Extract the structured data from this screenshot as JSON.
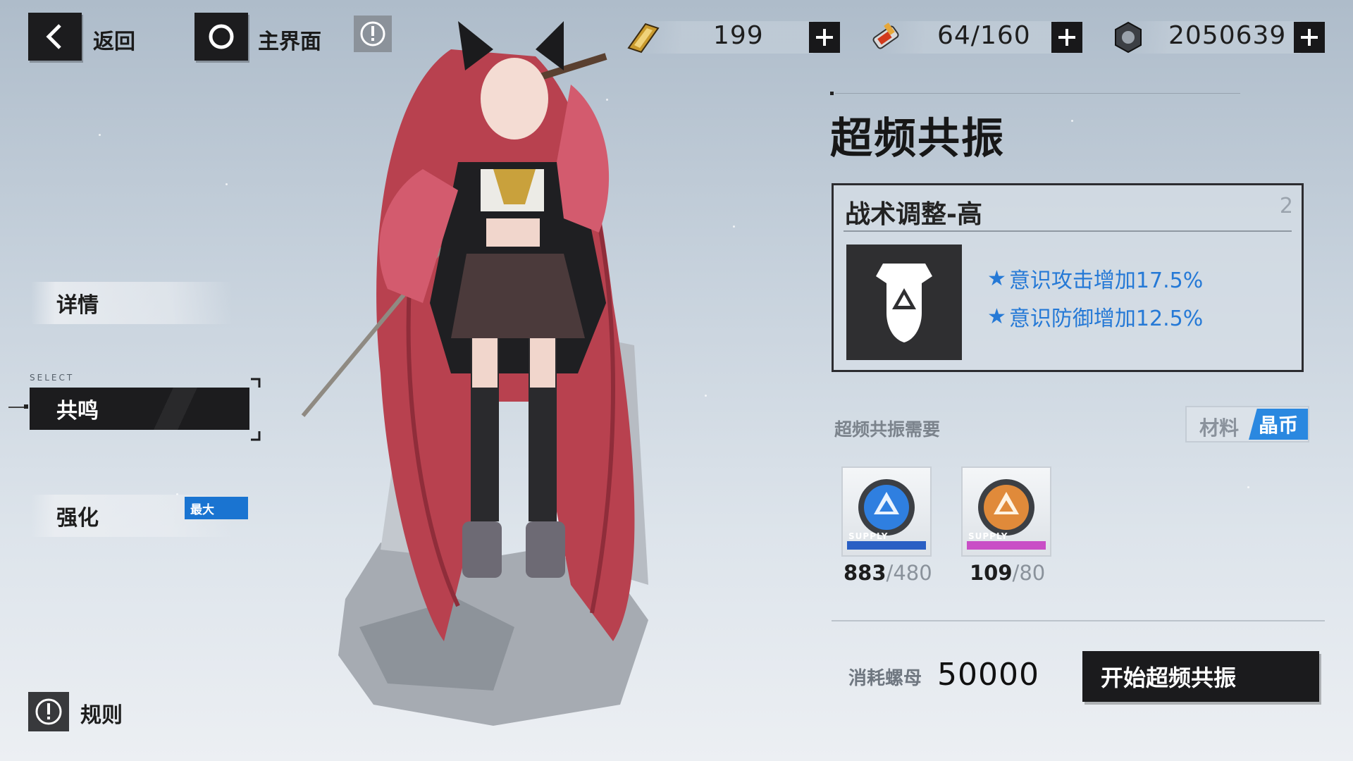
{
  "topbar": {
    "back_label": "返回",
    "home_label": "主界面",
    "resources": [
      {
        "icon": "energy-ticket-icon",
        "value": "199"
      },
      {
        "icon": "blood-serum-icon",
        "value": "64/160"
      },
      {
        "icon": "screw-nut-icon",
        "value": "2050639"
      }
    ]
  },
  "sidebar": {
    "items": [
      {
        "label": "详情"
      },
      {
        "label": "共鸣",
        "select_tag": "SELECT"
      },
      {
        "label": "强化",
        "badge": "最大"
      }
    ],
    "rules_label": "规则"
  },
  "panel": {
    "title": "超频共振",
    "card": {
      "name": "战术调整-高",
      "count": "2",
      "effects": [
        "意识攻击增加17.5%",
        "意识防御增加12.5%"
      ]
    },
    "requirements_label": "超频共振需要",
    "toggle": {
      "option_material": "材料",
      "option_crystal": "晶币"
    },
    "materials": [
      {
        "have": "883",
        "need": "/480",
        "tag": "SUPPLY",
        "color": "#2f7fe0"
      },
      {
        "have": "109",
        "need": "/80",
        "tag": "SUPPLY",
        "color": "#e08a3a"
      }
    ],
    "cost_label": "消耗螺母",
    "cost_value": "50000",
    "start_button": "开始超频共振"
  },
  "colors": {
    "accent": "#2a88e0",
    "effect_text": "#2579d6",
    "button_dark": "#1b1b1d"
  }
}
